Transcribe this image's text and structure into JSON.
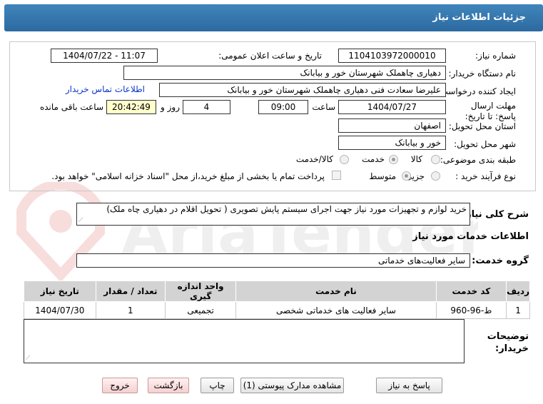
{
  "title": "جزئیات اطلاعات نیاز",
  "labels": {
    "need_number": "شماره نیاز:",
    "announce_datetime": "تاریخ و ساعت اعلان عمومی:",
    "buyer_org": "نام دستگاه خریدار:",
    "creator": "ایجاد کننده درخواست:",
    "deadline": "مهلت ارسال پاسخ: تا تاریخ:",
    "time_word": "ساعت",
    "day_and": "روز و",
    "remaining": "ساعت باقی مانده",
    "province": "استان محل تحویل:",
    "city": "شهر محل تحویل:",
    "category": "طبقه بندی موضوعی:",
    "process_type": "نوع فرآیند خرید :",
    "description": "شرح کلی نیاز:",
    "services_info": "اطلاعات خدمات مورد نیاز",
    "service_group": "گروه خدمت:",
    "buyer_notes": "توضیحات خریدار:"
  },
  "fields": {
    "need_number": "1104103972000010",
    "announce_datetime": "1404/07/22 - 11:07",
    "buyer_org": "دهیاری چاهملک شهرستان خور و بیابانک",
    "creator": "علیرضا سعادت فنی دهیاری چاهملک شهرستان خور و بیابانک",
    "contact_link": "اطلاعات تماس خریدار",
    "deadline_date": "1404/07/27",
    "deadline_time": "09:00",
    "days": "4",
    "remaining_time": "20:42:49",
    "province": "اصفهان",
    "city": "خور و بیابانک",
    "description": "خرید لوازم و تجهیزات مورد نیاز جهت اجرای سیستم پایش تصویری ( تحویل اقلام در دهیاری چاه ملک)",
    "service_group": "سایر فعالیت‌های خدماتی",
    "buyer_notes": ""
  },
  "category_options": [
    {
      "label": "کالا",
      "selected": false
    },
    {
      "label": "خدمت",
      "selected": true
    },
    {
      "label": "کالا/خدمت",
      "selected": false
    }
  ],
  "process_options": [
    {
      "label": "جزیی",
      "selected": false
    },
    {
      "label": "متوسط",
      "selected": true
    }
  ],
  "payment_note": "پرداخت تمام یا بخشی از مبلغ خرید،از محل \"اسناد خزانه اسلامی\" خواهد بود.",
  "table": {
    "headers": [
      "ردیف",
      "کد خدمت",
      "نام خدمت",
      "واحد اندازه گیری",
      "تعداد / مقدار",
      "تاریخ نیاز"
    ],
    "rows": [
      [
        "1",
        "ط-96-960",
        "سایر فعالیت های خدماتی شخصی",
        "تجمیعی",
        "1",
        "1404/07/30"
      ]
    ]
  },
  "buttons": {
    "reply": "پاسخ به نیاز",
    "attachments": "مشاهده مدارک پیوستی (1)",
    "print": "چاپ",
    "back": "بازگشت",
    "exit": "خروج"
  },
  "colors": {
    "header_bg": "#2f6fa7",
    "link": "#0a36c9",
    "highlight": "#ffffcc"
  }
}
